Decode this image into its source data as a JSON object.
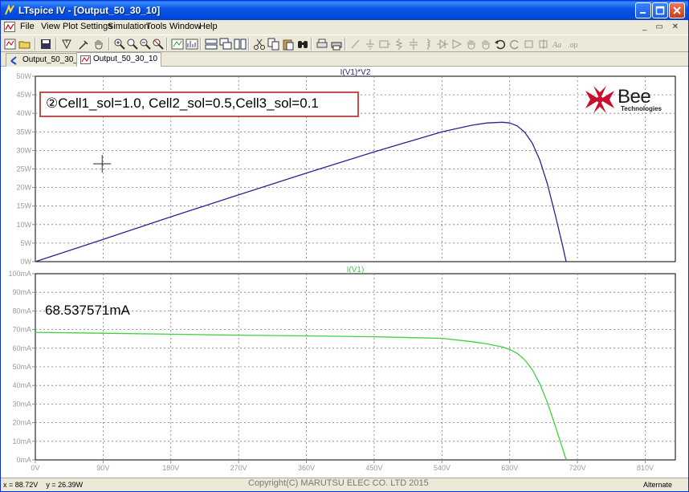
{
  "window": {
    "title": "LTspice IV - [Output_50_30_10]",
    "colors": {
      "titlebar": "#0a55e8",
      "border": "#0831d9"
    }
  },
  "menu": {
    "items": [
      {
        "label": "File"
      },
      {
        "label": "View"
      },
      {
        "label": "Plot Settings"
      },
      {
        "label": "Simulation"
      },
      {
        "label": "Tools"
      },
      {
        "label": "Window"
      },
      {
        "label": "Help"
      }
    ]
  },
  "toolbar": {
    "icons": [
      "schematic-icon",
      "open-icon",
      "save-icon",
      "wire-icon",
      "run-icon",
      "hand-icon",
      "zoom-in-icon",
      "zoom-area-icon",
      "zoom-out-icon",
      "zoom-cancel-icon",
      "autorange-icon",
      "fft-icon",
      "tile-horizontal-icon",
      "cascade-icon",
      "tile-vertical-icon",
      "cut-icon",
      "copy-icon",
      "paste-icon",
      "find-icon",
      "print-setup-icon",
      "print-icon",
      "draw-line-icon",
      "ground-icon",
      "label-icon",
      "resistor-icon",
      "capacitor-icon",
      "inductor-icon",
      "diode-icon",
      "component-icon",
      "move-icon",
      "drag-icon",
      "undo-icon",
      "redo-icon",
      "rotate-icon",
      "mirror-icon",
      "text-icon",
      "spice-directive-icon"
    ]
  },
  "tabs": [
    {
      "label": "Output_50_30_10",
      "active": false
    },
    {
      "label": "Output_50_30_10",
      "active": true
    }
  ],
  "annotation": {
    "text": "②Cell1_sol=1.0, Cell2_sol=0.5,Cell3_sol=0.1",
    "border_color": "#c0504d"
  },
  "value_label": "68.537571mA",
  "logo": {
    "name": "Bee",
    "sub": "Technologies",
    "color": "#c8102e"
  },
  "status": {
    "x_readout": "x = 88.72V",
    "y_readout": "y = 26.39W",
    "copyright": "Copyright(C) MARUTSU ELEC CO. LTD 2015",
    "mode": "Alternate"
  },
  "chart_data": [
    {
      "type": "line",
      "title": "I(V1)*V2",
      "x_ticks": [
        "0V",
        "90V",
        "180V",
        "270V",
        "360V",
        "450V",
        "540V",
        "630V",
        "720V",
        "810V"
      ],
      "y_ticks": [
        "0W",
        "5W",
        "10W",
        "15W",
        "20W",
        "25W",
        "30W",
        "35W",
        "40W",
        "45W",
        "50W"
      ],
      "xlim": [
        0,
        850
      ],
      "ylim": [
        0,
        50
      ],
      "grid": true,
      "series": [
        {
          "name": "I(V1)*V2",
          "color": "#26268c",
          "x": [
            0,
            90,
            180,
            270,
            360,
            450,
            540,
            580,
            600,
            620,
            630,
            640,
            650,
            660,
            670,
            680,
            690,
            700,
            705
          ],
          "y": [
            0,
            6.0,
            12.1,
            18.0,
            23.9,
            29.6,
            35.0,
            36.8,
            37.4,
            37.6,
            37.4,
            36.6,
            34.9,
            32.0,
            27.4,
            21.0,
            13.0,
            4.5,
            0
          ]
        }
      ],
      "cursor": {
        "x": 88.72,
        "y": 26.39
      }
    },
    {
      "type": "line",
      "title": "I(V1)",
      "x_ticks": [
        "0V",
        "90V",
        "180V",
        "270V",
        "360V",
        "450V",
        "540V",
        "630V",
        "720V",
        "810V"
      ],
      "y_ticks": [
        "0mA",
        "10mA",
        "20mA",
        "30mA",
        "40mA",
        "50mA",
        "60mA",
        "70mA",
        "80mA",
        "90mA",
        "100mA"
      ],
      "xlim": [
        0,
        850
      ],
      "ylim": [
        0,
        100
      ],
      "grid": true,
      "series": [
        {
          "name": "I(V1)",
          "color": "#3cd23c",
          "x": [
            0,
            90,
            180,
            270,
            360,
            450,
            540,
            580,
            600,
            620,
            630,
            640,
            650,
            660,
            670,
            680,
            690,
            700,
            705
          ],
          "y": [
            68.5,
            68.0,
            67.5,
            67.0,
            66.6,
            66.1,
            65.3,
            63.5,
            62.3,
            60.7,
            59.3,
            57.2,
            53.7,
            48.5,
            40.8,
            30.9,
            18.8,
            6.4,
            0
          ]
        }
      ]
    }
  ]
}
